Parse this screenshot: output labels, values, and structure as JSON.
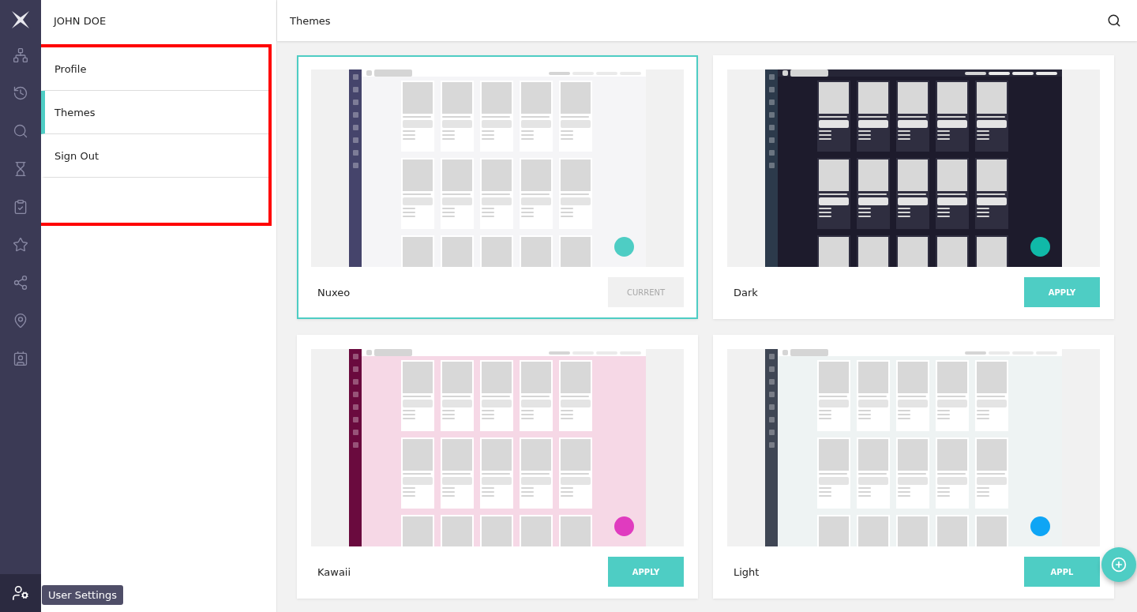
{
  "user": {
    "name": "JOHN DOE"
  },
  "menu": {
    "highlighted": true,
    "items": [
      {
        "label": "Profile",
        "selected": false
      },
      {
        "label": "Themes",
        "selected": true
      },
      {
        "label": "Sign Out",
        "selected": false
      }
    ]
  },
  "rail": {
    "tooltip": "User Settings"
  },
  "header": {
    "title": "Themes"
  },
  "themes": [
    {
      "name": "Nuxeo",
      "kind": "default",
      "selected": true,
      "button": "CURRENT",
      "color": "#4ecdc4"
    },
    {
      "name": "Dark",
      "kind": "dark",
      "selected": false,
      "button": "APPLY",
      "color": "#10b9a8"
    },
    {
      "name": "Kawaii",
      "kind": "pink",
      "selected": false,
      "button": "APPLY",
      "color": "#e03bbf"
    },
    {
      "name": "Light",
      "kind": "light",
      "selected": false,
      "button": "APPL",
      "color": "#0ea5f5"
    }
  ]
}
